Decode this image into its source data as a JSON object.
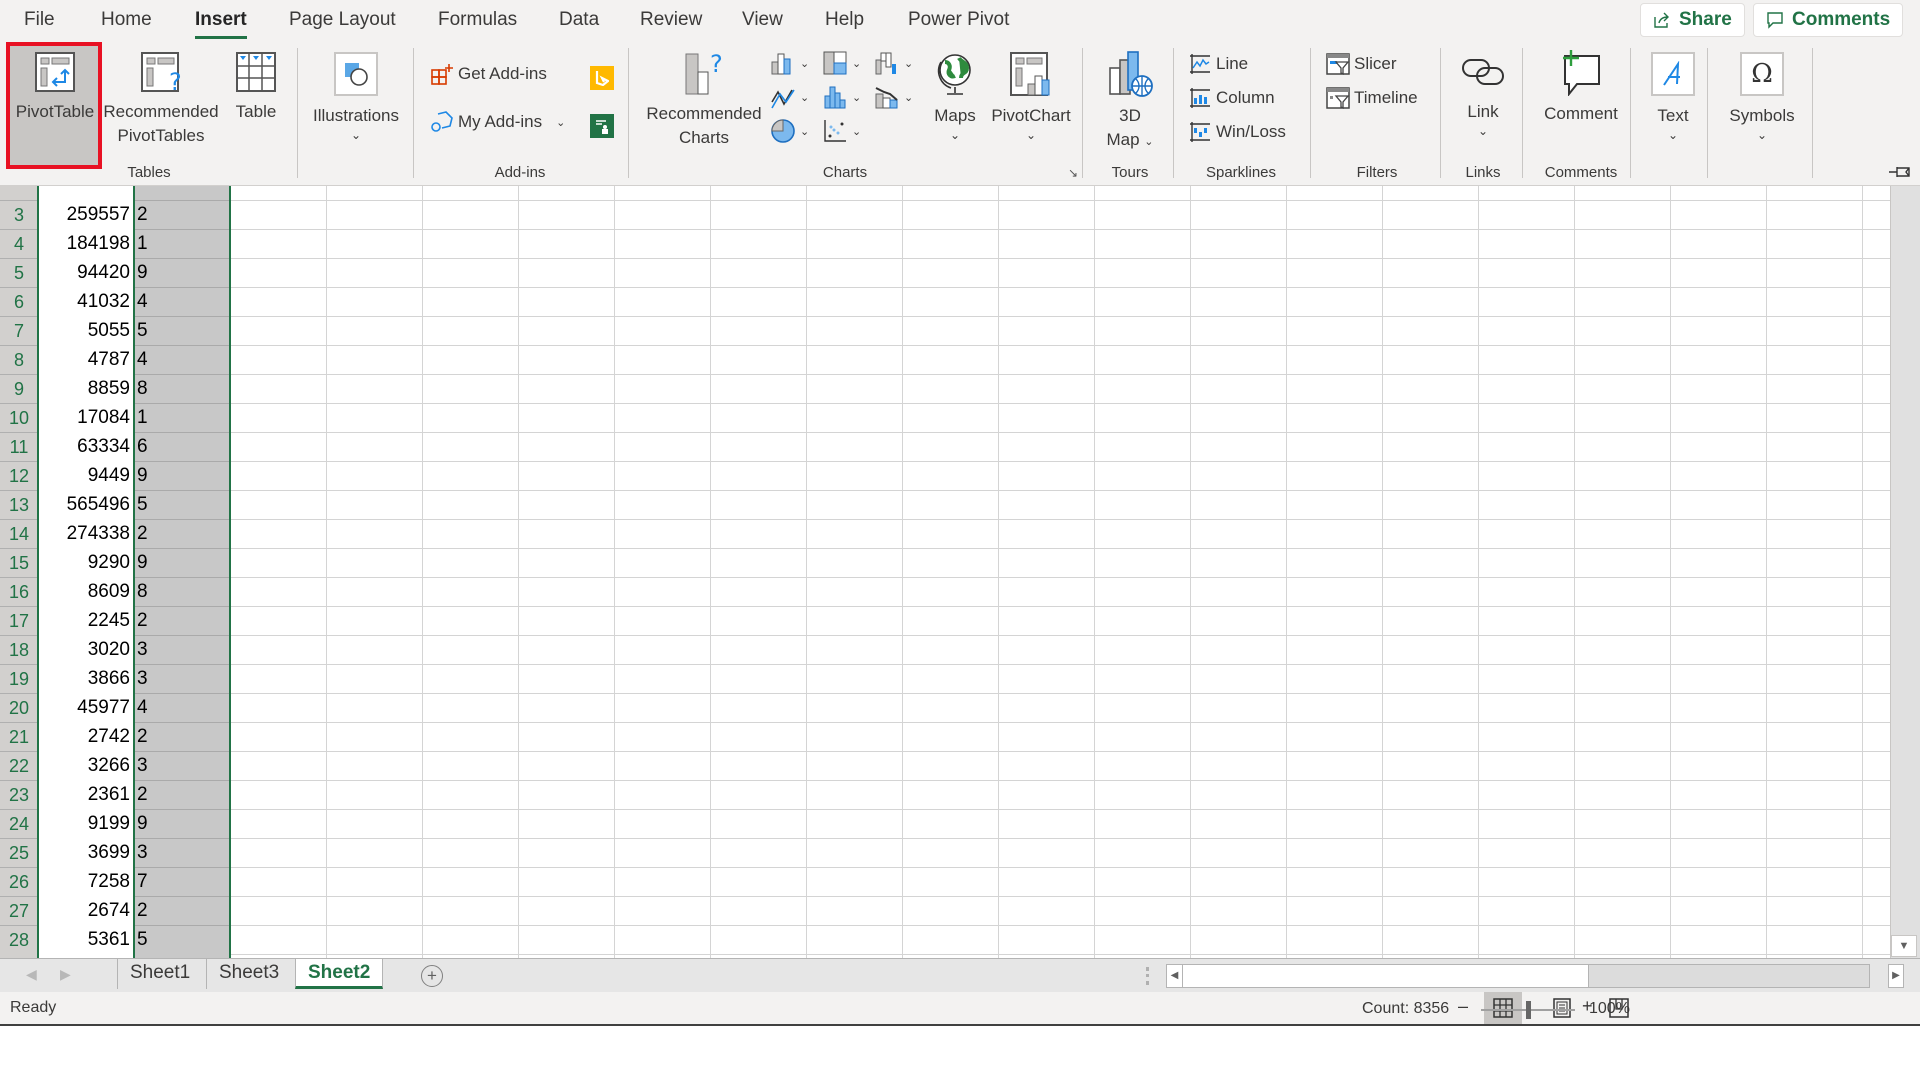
{
  "menu_tabs": [
    {
      "label": "File",
      "active": false
    },
    {
      "label": "Home",
      "active": false
    },
    {
      "label": "Insert",
      "active": true
    },
    {
      "label": "Page Layout",
      "active": false
    },
    {
      "label": "Formulas",
      "active": false
    },
    {
      "label": "Data",
      "active": false
    },
    {
      "label": "Review",
      "active": false
    },
    {
      "label": "View",
      "active": false
    },
    {
      "label": "Help",
      "active": false
    },
    {
      "label": "Power Pivot",
      "active": false
    }
  ],
  "top_buttons": {
    "share": "Share",
    "comments": "Comments"
  },
  "ribbon": {
    "tables": {
      "group_label": "Tables",
      "pivottable": "PivotTable",
      "recommended_pivottables_line1": "Recommended",
      "recommended_pivottables_line2": "PivotTables",
      "table": "Table"
    },
    "illustrations": {
      "label": "Illustrations"
    },
    "addins": {
      "group_label": "Add-ins",
      "get_addins": "Get Add-ins",
      "my_addins": "My Add-ins"
    },
    "charts": {
      "group_label": "Charts",
      "recommended_charts_line1": "Recommended",
      "recommended_charts_line2": "Charts",
      "maps": "Maps",
      "pivotchart": "PivotChart"
    },
    "tours": {
      "group_label": "Tours",
      "map_line1": "3D",
      "map_line2": "Map"
    },
    "sparklines": {
      "group_label": "Sparklines",
      "line": "Line",
      "column": "Column",
      "winloss": "Win/Loss"
    },
    "filters": {
      "group_label": "Filters",
      "slicer": "Slicer",
      "timeline": "Timeline"
    },
    "links": {
      "group_label": "Links",
      "link": "Link"
    },
    "comments": {
      "group_label": "Comments",
      "comment": "Comment"
    },
    "text": {
      "label": "Text"
    },
    "symbols": {
      "label": "Symbols"
    }
  },
  "sheet": {
    "rows": [
      {
        "num": "3",
        "a": "259557",
        "b": "2"
      },
      {
        "num": "4",
        "a": "184198",
        "b": "1"
      },
      {
        "num": "5",
        "a": "94420",
        "b": "9"
      },
      {
        "num": "6",
        "a": "41032",
        "b": "4"
      },
      {
        "num": "7",
        "a": "5055",
        "b": "5"
      },
      {
        "num": "8",
        "a": "4787",
        "b": "4"
      },
      {
        "num": "9",
        "a": "8859",
        "b": "8"
      },
      {
        "num": "10",
        "a": "17084",
        "b": "1"
      },
      {
        "num": "11",
        "a": "63334",
        "b": "6"
      },
      {
        "num": "12",
        "a": "9449",
        "b": "9"
      },
      {
        "num": "13",
        "a": "565496",
        "b": "5"
      },
      {
        "num": "14",
        "a": "274338",
        "b": "2"
      },
      {
        "num": "15",
        "a": "9290",
        "b": "9"
      },
      {
        "num": "16",
        "a": "8609",
        "b": "8"
      },
      {
        "num": "17",
        "a": "2245",
        "b": "2"
      },
      {
        "num": "18",
        "a": "3020",
        "b": "3"
      },
      {
        "num": "19",
        "a": "3866",
        "b": "3"
      },
      {
        "num": "20",
        "a": "45977",
        "b": "4"
      },
      {
        "num": "21",
        "a": "2742",
        "b": "2"
      },
      {
        "num": "22",
        "a": "3266",
        "b": "3"
      },
      {
        "num": "23",
        "a": "2361",
        "b": "2"
      },
      {
        "num": "24",
        "a": "9199",
        "b": "9"
      },
      {
        "num": "25",
        "a": "3699",
        "b": "3"
      },
      {
        "num": "26",
        "a": "7258",
        "b": "7"
      },
      {
        "num": "27",
        "a": "2674",
        "b": "2"
      },
      {
        "num": "28",
        "a": "5361",
        "b": "5"
      }
    ]
  },
  "sheet_tabs": [
    {
      "label": "Sheet1",
      "active": false
    },
    {
      "label": "Sheet3",
      "active": false
    },
    {
      "label": "Sheet2",
      "active": true
    }
  ],
  "status": {
    "ready": "Ready",
    "count": "Count: 8356",
    "zoom": "100%",
    "zoom_percent": 100
  },
  "colors": {
    "accent": "#217346",
    "highlight": "#e81123"
  }
}
